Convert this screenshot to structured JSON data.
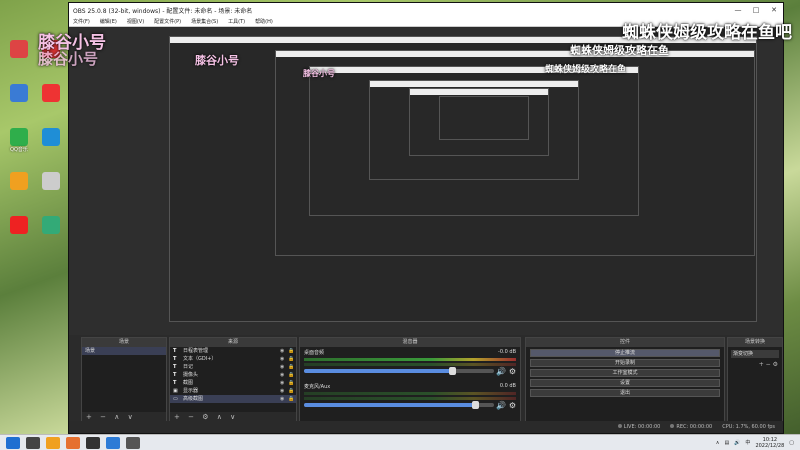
{
  "overlays": {
    "left_line1": "膝谷小号",
    "left_line2": "膝谷小号",
    "right_top": "蜘蛛侠姆级攻略在鱼吧",
    "right_nested1": "蜘蛛侠姆级攻略在鱼",
    "right_nested2": "蜘蛛侠姆级攻略在鱼",
    "mid_nested1": "膝谷小号",
    "mid_nested2": "膝谷小号"
  },
  "desktop_icons": [
    {
      "label": "",
      "color": "#d44"
    },
    {
      "label": "",
      "color": "#d33"
    },
    {
      "label": "",
      "color": "#3a7bd5"
    },
    {
      "label": "",
      "color": "#e33"
    },
    {
      "label": "QQ音乐",
      "color": "#2fae4b"
    },
    {
      "label": "",
      "color": "#1f8ed6"
    },
    {
      "label": "",
      "color": "#f0a020"
    },
    {
      "label": "",
      "color": "#ccc"
    },
    {
      "label": "",
      "color": "#e22"
    },
    {
      "label": "",
      "color": "#3a7"
    }
  ],
  "window": {
    "title": "OBS 25.0.8 (32-bit, windows) - 配置文件: 未命名 - 场景: 未命名",
    "menu": [
      "文件(F)",
      "编辑(E)",
      "视图(V)",
      "配置文件(P)",
      "场景集合(S)",
      "工具(T)",
      "帮助(H)"
    ]
  },
  "scenes": {
    "header": "场景",
    "items": [
      "场景"
    ],
    "footer": [
      "+",
      "−",
      "∧",
      "∨"
    ]
  },
  "sources": {
    "header": "来源",
    "items": [
      {
        "icon": "T",
        "label": "日程表管理"
      },
      {
        "icon": "T",
        "label": "文本（GDI+）"
      },
      {
        "icon": "T",
        "label": "日记"
      },
      {
        "icon": "T",
        "label": "摄像头"
      },
      {
        "icon": "T",
        "label": "截图"
      },
      {
        "icon": "▣",
        "label": "显示器"
      },
      {
        "icon": "▭",
        "label": "高级截图"
      }
    ],
    "footer": [
      "+",
      "−",
      "⚙",
      "∧",
      "∨"
    ]
  },
  "mixer": {
    "header": "混音器",
    "channels": [
      {
        "name": "桌面音频",
        "db": "-0.0 dB",
        "level": 0.78
      },
      {
        "name": "麦克风/Aux",
        "db": "0.0 dB",
        "level": 0.9
      }
    ]
  },
  "controls": {
    "header": "控件",
    "buttons": [
      "停止推流",
      "开始录制",
      "工作室模式",
      "设置",
      "退出"
    ]
  },
  "transitions": {
    "header": "场景转换",
    "selected": "渐变切换",
    "footer": [
      "+",
      "−",
      "⚙"
    ]
  },
  "status": {
    "live": "LIVE: 00:00:00",
    "rec": "REC: 00:00:00",
    "cpu": "CPU: 1.7%, 60.00 fps"
  },
  "taskbar": {
    "time": "10:12",
    "date": "2022/12/28",
    "lang": "中"
  }
}
